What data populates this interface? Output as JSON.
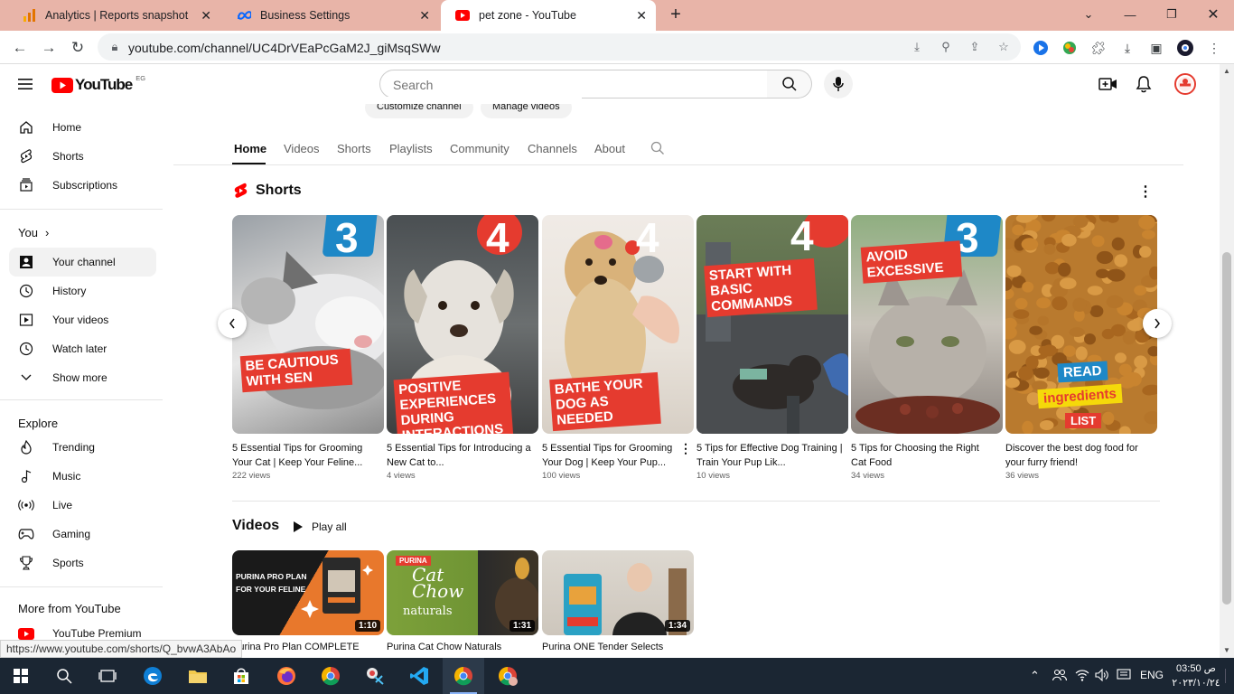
{
  "browser": {
    "tabs": [
      {
        "title": "Analytics | Reports snapshot",
        "icon": "analytics-icon",
        "active": false
      },
      {
        "title": "Business Settings",
        "icon": "meta-icon",
        "active": false
      },
      {
        "title": "pet zone - YouTube",
        "icon": "youtube-icon",
        "active": true
      }
    ],
    "new_tab_label": "+",
    "url": "youtube.com/channel/UC4DrVEaPcGaM2J_giMsqSWw"
  },
  "youtube": {
    "logo_text": "YouTube",
    "region": "EG",
    "search_placeholder": "Search",
    "sidebar": {
      "main": [
        {
          "label": "Home",
          "icon": "home-icon"
        },
        {
          "label": "Shorts",
          "icon": "shorts-icon"
        },
        {
          "label": "Subscriptions",
          "icon": "subscriptions-icon"
        }
      ],
      "you_heading": "You",
      "you": [
        {
          "label": "Your channel",
          "icon": "your-channel-icon",
          "selected": true
        },
        {
          "label": "History",
          "icon": "history-icon"
        },
        {
          "label": "Your videos",
          "icon": "your-videos-icon"
        },
        {
          "label": "Watch later",
          "icon": "watch-later-icon"
        },
        {
          "label": "Show more",
          "icon": "chevron-down-icon"
        }
      ],
      "explore_heading": "Explore",
      "explore": [
        {
          "label": "Trending",
          "icon": "trending-icon"
        },
        {
          "label": "Music",
          "icon": "music-icon"
        },
        {
          "label": "Live",
          "icon": "live-icon"
        },
        {
          "label": "Gaming",
          "icon": "gaming-icon"
        },
        {
          "label": "Sports",
          "icon": "sports-icon"
        }
      ],
      "more_heading": "More from YouTube",
      "more": [
        {
          "label": "YouTube Premium",
          "icon": "youtube-premium-icon"
        }
      ]
    },
    "channel_buttons": {
      "customize": "Customize channel",
      "manage": "Manage videos"
    },
    "channel_tabs": [
      "Home",
      "Videos",
      "Shorts",
      "Playlists",
      "Community",
      "Channels",
      "About"
    ],
    "shorts_section": {
      "title": "Shorts",
      "items": [
        {
          "title": "5 Essential Tips for Grooming Your Cat | Keep Your Feline...",
          "views": "222 views",
          "overlay_number": "3",
          "overlay_text": "BE CAUTIOUS WITH SEN"
        },
        {
          "title": "5 Essential Tips for Introducing a New Cat to...",
          "views": "4 views",
          "overlay_number": "4",
          "overlay_text": "POSITIVE EXPERIENCES DURING INTERACTIONS"
        },
        {
          "title": "5 Essential Tips for Grooming Your Dog | Keep Your Pup...",
          "views": "100 views",
          "overlay_number": "4",
          "overlay_text": "BATHE YOUR DOG AS NEEDED"
        },
        {
          "title": "5 Tips for Effective Dog Training | Train Your Pup Lik...",
          "views": "10 views",
          "overlay_number": "4",
          "overlay_text": "START WITH BASIC COMMANDS"
        },
        {
          "title": "5 Tips for Choosing the Right Cat Food",
          "views": "34 views",
          "overlay_number": "3",
          "overlay_text": "AVOID EXCESSIVE"
        },
        {
          "title": "Discover the best dog food for your furry friend!",
          "views": "36 views",
          "overlay_text_1": "READ",
          "overlay_text_2": "ingredients",
          "overlay_text_3": "LIST"
        }
      ]
    },
    "videos_section": {
      "title": "Videos",
      "play_all": "Play all",
      "items": [
        {
          "title": "Purina Pro Plan COMPLETE",
          "duration": "1:10",
          "thumb_text": "PURINA PRO PLAN FOR YOUR FELINE"
        },
        {
          "title": "Purina Cat Chow Naturals",
          "duration": "1:31",
          "thumb_text_1": "PURINA",
          "thumb_text_2": "Cat Chow",
          "thumb_text_3": "naturals"
        },
        {
          "title": "Purina ONE Tender Selects",
          "duration": "1:34"
        }
      ]
    },
    "status_url": "https://www.youtube.com/shorts/Q_bvwA3AbAo"
  },
  "taskbar": {
    "language": "ENG",
    "time": "03:50 ص",
    "date": "٢٠٢٣/١٠/٢٤"
  },
  "colors": {
    "youtube_red": "#ff0000",
    "overlay_red": "#e53b2f",
    "overlay_blue": "#1e88c7",
    "tabstrip": "#e8b4a8"
  }
}
